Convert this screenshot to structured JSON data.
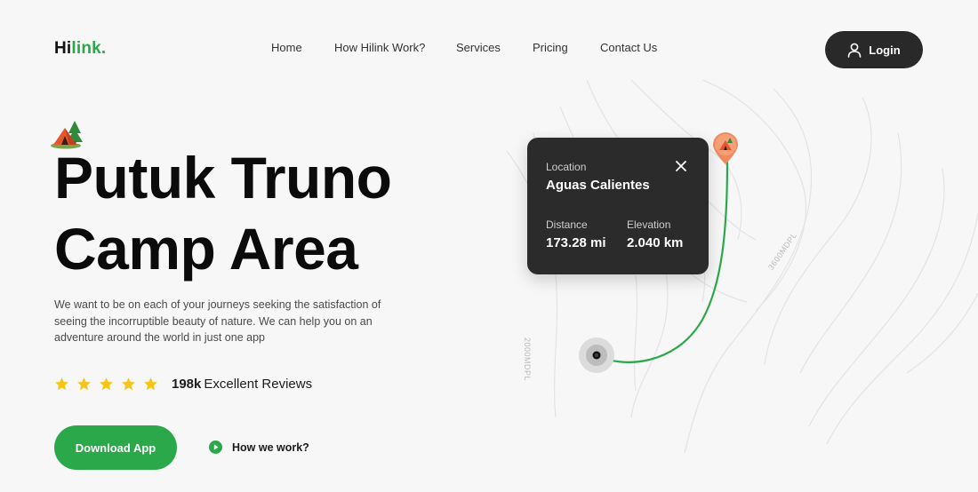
{
  "header": {
    "logo_part1": "Hi",
    "logo_part2": "link.",
    "nav": [
      "Home",
      "How Hilink Work?",
      "Services",
      "Pricing",
      "Contact Us"
    ],
    "login_label": "Login"
  },
  "hero": {
    "title_line1": "Putuk Truno",
    "title_line2": "Camp Area",
    "description": "We want to be on each of your journeys seeking the satisfaction of seeing the incorruptible beauty of nature. We can help you on an adventure around the world in just one app",
    "rating_stars": 5,
    "reviews_count": "198k",
    "reviews_label": "Excellent Reviews",
    "download_label": "Download App",
    "how_label": "How we work?"
  },
  "map": {
    "location_label": "Location",
    "location_value": "Aguas Calientes",
    "distance_label": "Distance",
    "distance_value": "173.28 mi",
    "elevation_label": "Elevation",
    "elevation_value": "2.040 km",
    "contour_label_1": "2000MDPL",
    "contour_label_2": "3600MDPL"
  },
  "colors": {
    "accent": "#2ba84a",
    "dark": "#292929",
    "pin": "#f08a5d",
    "star": "#f5c518"
  }
}
